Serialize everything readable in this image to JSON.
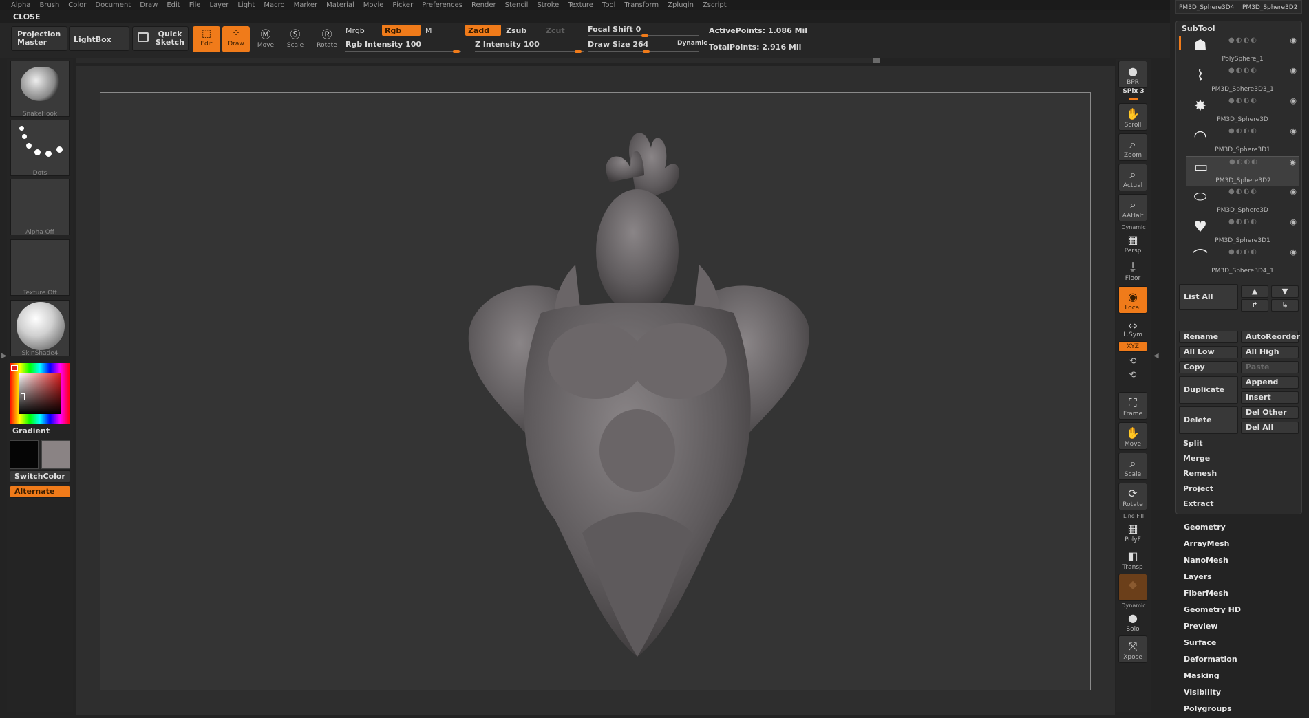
{
  "menu": [
    "Alpha",
    "Brush",
    "Color",
    "Document",
    "Draw",
    "Edit",
    "File",
    "Layer",
    "Light",
    "Macro",
    "Marker",
    "Material",
    "Movie",
    "Picker",
    "Preferences",
    "Render",
    "Stencil",
    "Stroke",
    "Texture",
    "Tool",
    "Transform",
    "Zplugin",
    "Zscript"
  ],
  "close_label": "CLOSE",
  "top_right_tabs": [
    "PM3D_Sphere3D4",
    "PM3D_Sphere3D2"
  ],
  "toolbar": {
    "projection_master": "Projection Master",
    "lightbox": "LightBox",
    "quick_sketch": "Quick Sketch",
    "edit": "Edit",
    "draw": "Draw",
    "move": "Move",
    "scale": "Scale",
    "rotate": "Rotate",
    "mrgb": "Mrgb",
    "rgb": "Rgb",
    "m": "M",
    "zadd": "Zadd",
    "zsub": "Zsub",
    "zcut": "Zcut",
    "rgb_intensity": "Rgb Intensity 100",
    "z_intensity": "Z Intensity 100",
    "focal_shift": "Focal Shift 0",
    "draw_size": "Draw Size 264",
    "dynamic": "Dynamic",
    "active_points": "ActivePoints: 1.086 Mil",
    "total_points": "TotalPoints: 2.916 Mil"
  },
  "leftpanel": {
    "brush": "SnakeHook",
    "stroke": "Dots",
    "alpha": "Alpha Off",
    "texture": "Texture Off",
    "material": "SkinShade4",
    "gradient": "Gradient",
    "switchcolor": "SwitchColor",
    "alternate": "Alternate"
  },
  "shelf": {
    "bpr": "BPR",
    "spix": "SPix 3",
    "scroll": "Scroll",
    "zoom": "Zoom",
    "actual": "Actual",
    "aahalf": "AAHalf",
    "dynamic": "Dynamic",
    "persp": "Persp",
    "floor": "Floor",
    "local": "Local",
    "lsym": "L.Sym",
    "xyz": "XYZ",
    "frame": "Frame",
    "move": "Move",
    "scale": "Scale",
    "rotate": "Rotate",
    "linefill": "Line Fill",
    "polyf": "PolyF",
    "transp": "Transp",
    "dynamic2": "Dynamic",
    "solo": "Solo",
    "xpose": "Xpose"
  },
  "subtool": {
    "title": "SubTool",
    "items": [
      "PolySphere_1",
      "PM3D_Sphere3D3_1",
      "PM3D_Sphere3D",
      "PM3D_Sphere3D1",
      "PM3D_Sphere3D2",
      "PM3D_Sphere3D",
      "PM3D_Sphere3D1",
      "PM3D_Sphere3D4_1"
    ],
    "list_all": "List All",
    "rename": "Rename",
    "autoreorder": "AutoReorder",
    "all_low": "All Low",
    "all_high": "All High",
    "copy": "Copy",
    "paste": "Paste",
    "duplicate": "Duplicate",
    "append": "Append",
    "insert": "Insert",
    "delete": "Delete",
    "del_other": "Del Other",
    "del_all": "Del All",
    "split": "Split",
    "merge": "Merge",
    "remesh": "Remesh",
    "project": "Project",
    "extract": "Extract"
  },
  "tool_menus": [
    "Geometry",
    "ArrayMesh",
    "NanoMesh",
    "Layers",
    "FiberMesh",
    "Geometry HD",
    "Preview",
    "Surface",
    "Deformation",
    "Masking",
    "Visibility",
    "Polygroups"
  ],
  "colors": {
    "accent": "#f07b1a",
    "bg": "#232323",
    "canvas": "#343434"
  }
}
